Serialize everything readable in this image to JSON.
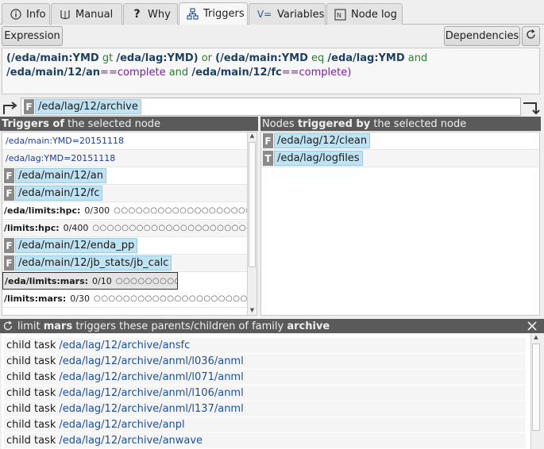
{
  "tabs": [
    {
      "label": "Info",
      "icon": "info-icon"
    },
    {
      "label": "Manual",
      "icon": "manual-icon"
    },
    {
      "label": "Why",
      "icon": "question-icon"
    },
    {
      "label": "Triggers",
      "icon": "triggers-icon"
    },
    {
      "label": "Variables",
      "icon": "variables-icon"
    },
    {
      "label": "Node log",
      "icon": "nodelog-icon"
    }
  ],
  "active_tab": "Triggers",
  "toolbar": {
    "expression_label": "Expression",
    "dependencies_label": "Dependencies"
  },
  "expression": {
    "p1": "(/eda/main:YMD",
    "op_gt": "gt",
    "p2": "/eda/lag:YMD)",
    "op_or": "or",
    "p3": "(/eda/main:YMD",
    "op_eq": "eq",
    "p4": "/eda/lag:YMD",
    "op_and1": "and",
    "p5": "/eda/main/12/an",
    "eqeq1": "==",
    "v1": "complete",
    "op_and2": "and",
    "p6": "/eda/main/12/fc",
    "eqeq2": "==",
    "v2": "complete)"
  },
  "path_bar": {
    "badge": "F",
    "path": "/eda/lag/12/archive"
  },
  "left_panel": {
    "title_bold": "Triggers of",
    "title_rest": " the selected node",
    "rows": [
      {
        "kind": "var",
        "text": "/eda/main:YMD=20151118"
      },
      {
        "kind": "var",
        "text": "/eda/lag:YMD=20151118"
      },
      {
        "kind": "node",
        "badge": "F",
        "text": "/eda/main/12/an"
      },
      {
        "kind": "node",
        "badge": "F",
        "text": "/eda/main/12/fc"
      },
      {
        "kind": "limit",
        "name": "/eda/limits:hpc:",
        "value": "0/300",
        "dots": "○○○○○○○○○○○○○○○○○○○○○○○○○○○○"
      },
      {
        "kind": "limit",
        "name": "/limits:hpc:",
        "value": "0/400",
        "dots": "○○○○○○○○○○○○○○○○○○○○○○○○○○○○○"
      },
      {
        "kind": "node",
        "badge": "F",
        "text": "/eda/main/12/enda_pp"
      },
      {
        "kind": "node",
        "badge": "F",
        "text": "/eda/main/12/jb_stats/jb_calc"
      },
      {
        "kind": "limit",
        "name": "/eda/limits:mars:",
        "value": "0/10",
        "dots": "○○○○○○○○○○"
      },
      {
        "kind": "limit",
        "name": "/limits:mars:",
        "value": "0/30",
        "dots": "○○○○○○○○○○○○○○○○○○○○○○○○○○○○○"
      }
    ]
  },
  "right_panel": {
    "title_pre": "Nodes ",
    "title_bold": "triggered by",
    "title_rest": " the selected node",
    "rows": [
      {
        "badge": "F",
        "text": "/eda/lag/12/clean"
      },
      {
        "badge": "T",
        "text": "/eda/lag/logfiles"
      }
    ]
  },
  "bottom_panel": {
    "t1": "limit ",
    "t2": "mars",
    "t3": " triggers these parents/children of family ",
    "t4": "archive",
    "rows": [
      {
        "type": "child task",
        "path": "/eda/lag/12/archive/ansfc"
      },
      {
        "type": "child task",
        "path": "/eda/lag/12/archive/anml/l036/anml"
      },
      {
        "type": "child task",
        "path": "/eda/lag/12/archive/anml/l071/anml"
      },
      {
        "type": "child task",
        "path": "/eda/lag/12/archive/anml/l106/anml"
      },
      {
        "type": "child task",
        "path": "/eda/lag/12/archive/anml/l137/anml"
      },
      {
        "type": "child task",
        "path": "/eda/lag/12/archive/anpl"
      },
      {
        "type": "child task",
        "path": "/eda/lag/12/archive/anwave"
      }
    ]
  }
}
